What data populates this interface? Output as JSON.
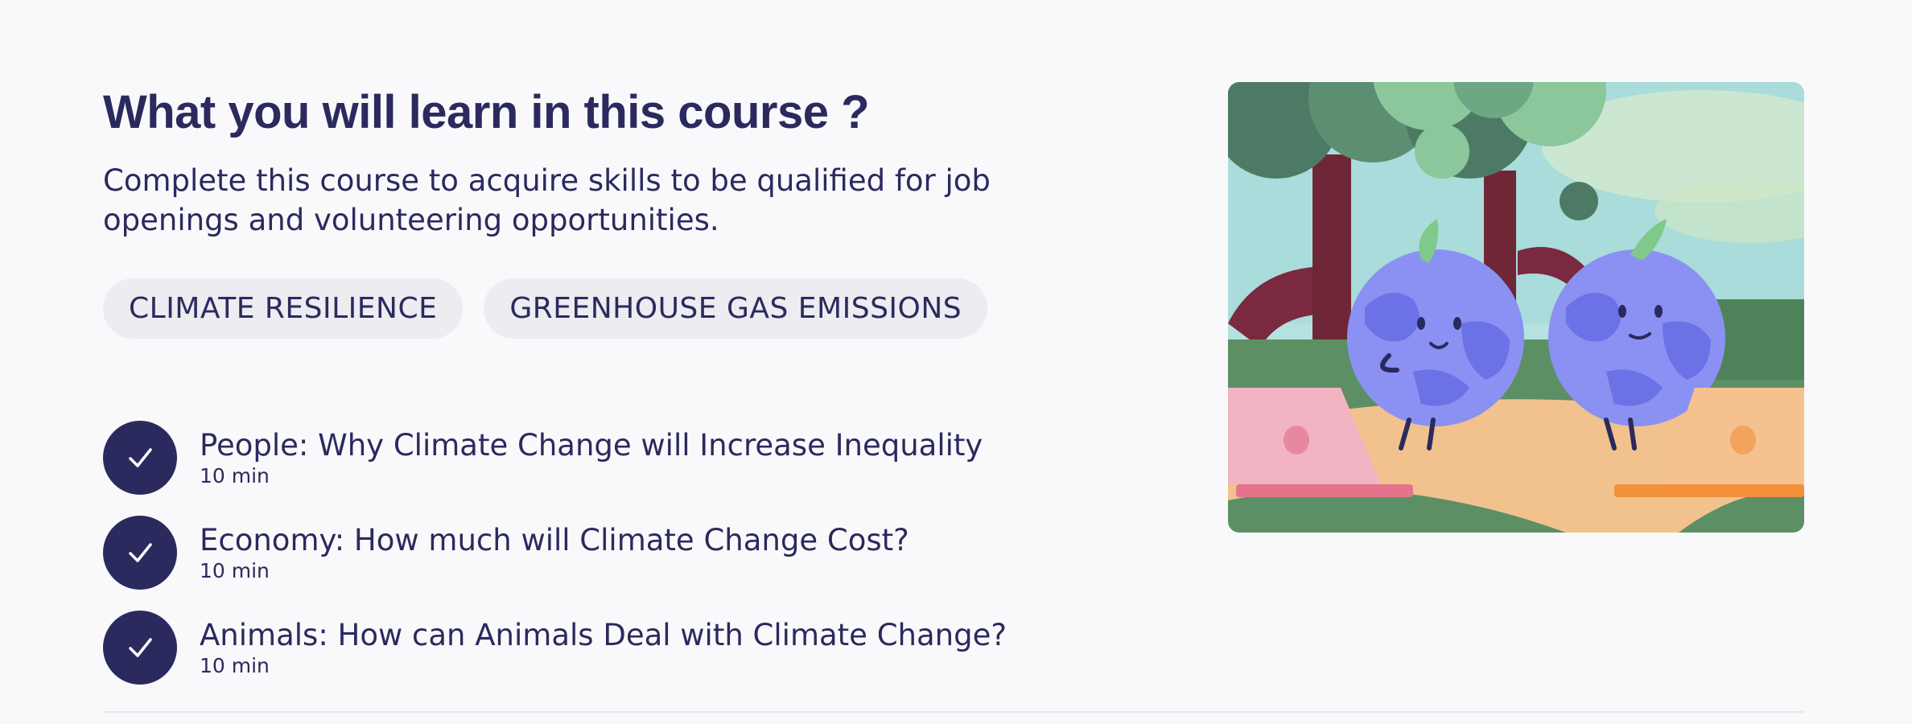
{
  "section": {
    "title": "What you will learn in this course ?",
    "description": "Complete this course to acquire skills to be qualified for job openings and volunteering opportunities."
  },
  "tags": [
    {
      "label": "CLIMATE RESILIENCE"
    },
    {
      "label": "GREENHOUSE GAS EMISSIONS"
    }
  ],
  "lessons": [
    {
      "title": "People: Why Climate Change will Increase Inequality",
      "duration": "10 min",
      "completed": true
    },
    {
      "title": "Economy: How much will Climate Change Cost?",
      "duration": "10 min",
      "completed": true
    },
    {
      "title": "Animals: How can Animals Deal with Climate Change?",
      "duration": "10 min",
      "completed": true
    }
  ],
  "colors": {
    "text": "#2b2a5e",
    "check_bg": "#2b2a5e",
    "tag_bg": "#ececf1",
    "background": "#f9f9fb"
  },
  "illustration": {
    "icon": "two-earth-characters-with-laptops-illustration"
  }
}
